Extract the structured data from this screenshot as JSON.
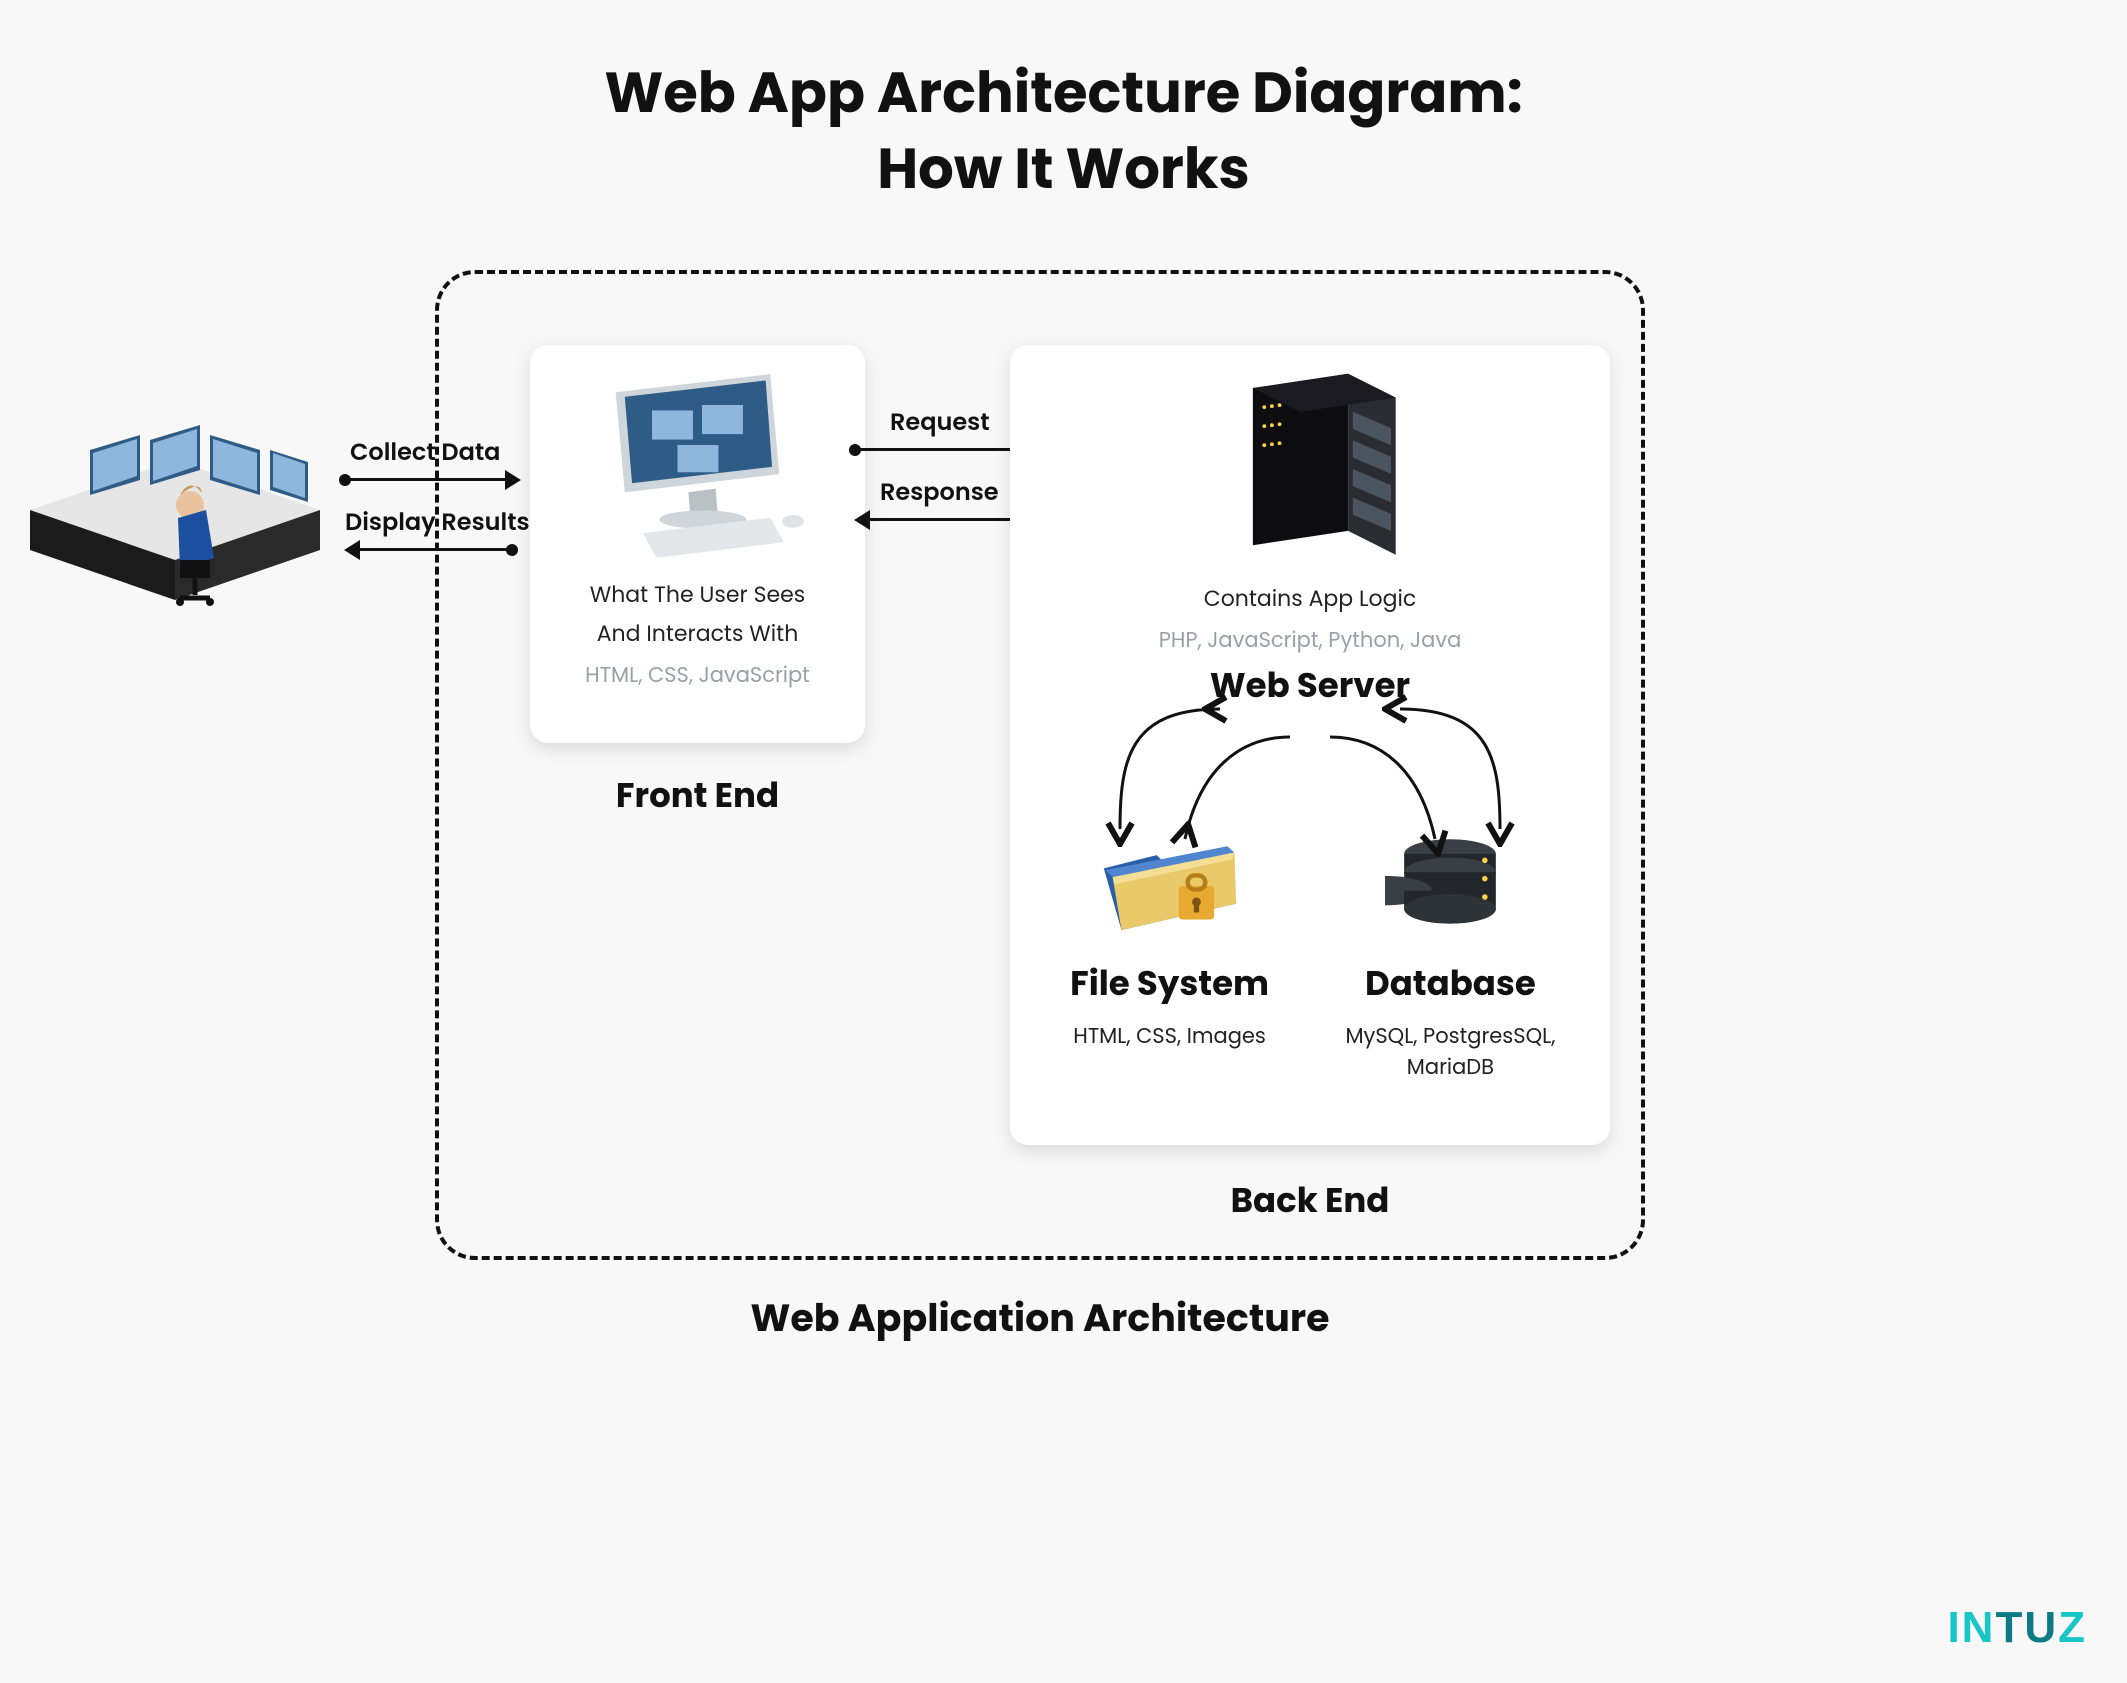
{
  "title": {
    "line1": "Web App Architecture Diagram:",
    "line2": "How It Works"
  },
  "container_caption": "Web Application Architecture",
  "user_to_frontend": {
    "top_label": "Collect Data",
    "bottom_label": "Display Results"
  },
  "frontend_to_backend": {
    "top_label": "Request",
    "bottom_label": "Response"
  },
  "frontend": {
    "section_label": "Front End",
    "desc_line1": "What The User Sees",
    "desc_line2": "And Interacts With",
    "tech": "HTML, CSS, JavaScript"
  },
  "backend": {
    "section_label": "Back End",
    "webserver": {
      "desc": "Contains App Logic",
      "tech": "PHP, JavaScript, Python, Java",
      "title": "Web Server"
    },
    "filesystem": {
      "title": "File System",
      "tech": "HTML, CSS, Images"
    },
    "database": {
      "title": "Database",
      "tech": "MySQL, PostgresSQL, MariaDB"
    }
  },
  "brand": "INTUZ"
}
